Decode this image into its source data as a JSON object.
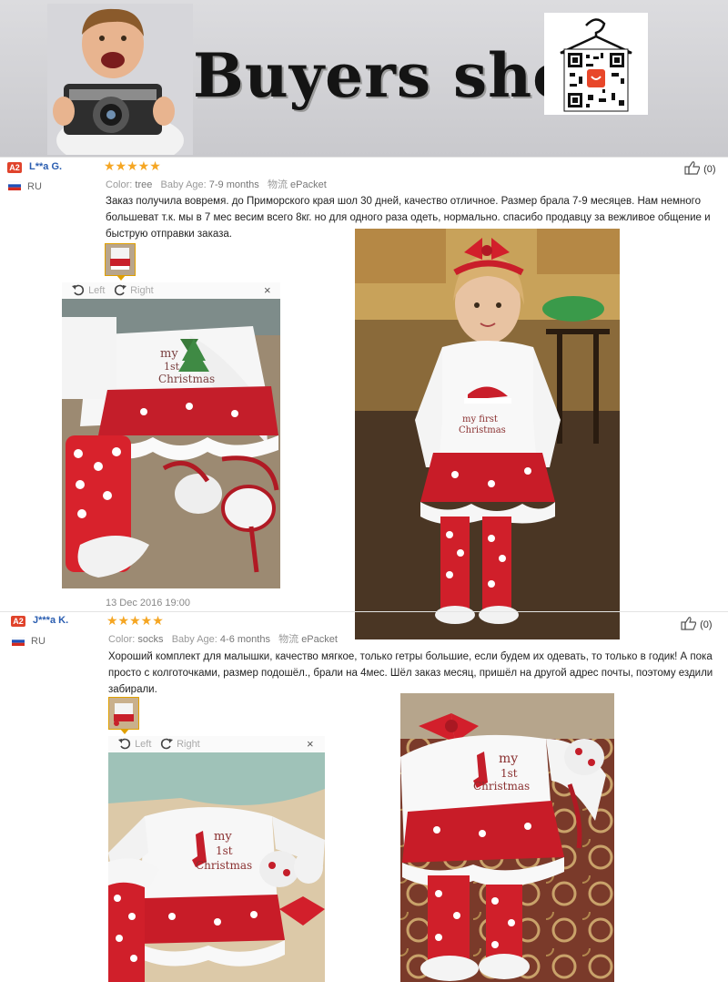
{
  "banner": {
    "title": "Buyers show",
    "qr_label": "QR code"
  },
  "reviews": [
    {
      "badge": "A2",
      "user": "L**a G.",
      "country": "RU",
      "stars": "★★★★★",
      "color_label": "Color:",
      "color_value": "tree",
      "age_label": "Baby Age:",
      "age_value": "7-9 months",
      "ship_label": "物流",
      "ship_value": "ePacket",
      "likes": "(0)",
      "text": "Заказ получила вовремя. до Приморского края шол 30 дней, качество отличное. Размер брала 7-9 месяцев. Нам немного большеват т.к. мы в 7 мес весим всего 8кг. но для одного раза одеть, нормально. спасибо продавцу за вежливое общение и быструю отправки заказа.",
      "viewer_left": "Left",
      "viewer_right": "Right",
      "close": "×",
      "date": "13 Dec 2016 19:00"
    },
    {
      "badge": "A2",
      "user": "J***a K.",
      "country": "RU",
      "stars": "★★★★★",
      "color_label": "Color:",
      "color_value": "socks",
      "age_label": "Baby Age:",
      "age_value": "4-6 months",
      "ship_label": "物流",
      "ship_value": "ePacket",
      "likes": "(0)",
      "text": "Хороший комплект для малышки, качество мягкое, только гетры большие, если будем их одевать, то только в годик! А пока просто с колготочками, размер подошёл., брали на 4мес. Шёл заказ месяц, пришёл на другой адрес почты, поэтому ездили забирали.",
      "viewer_left": "Left",
      "viewer_right": "Right",
      "close": "×"
    }
  ],
  "colors": {
    "accent": "#2a5db0",
    "star": "#f5a623",
    "badge": "#e0432b"
  }
}
